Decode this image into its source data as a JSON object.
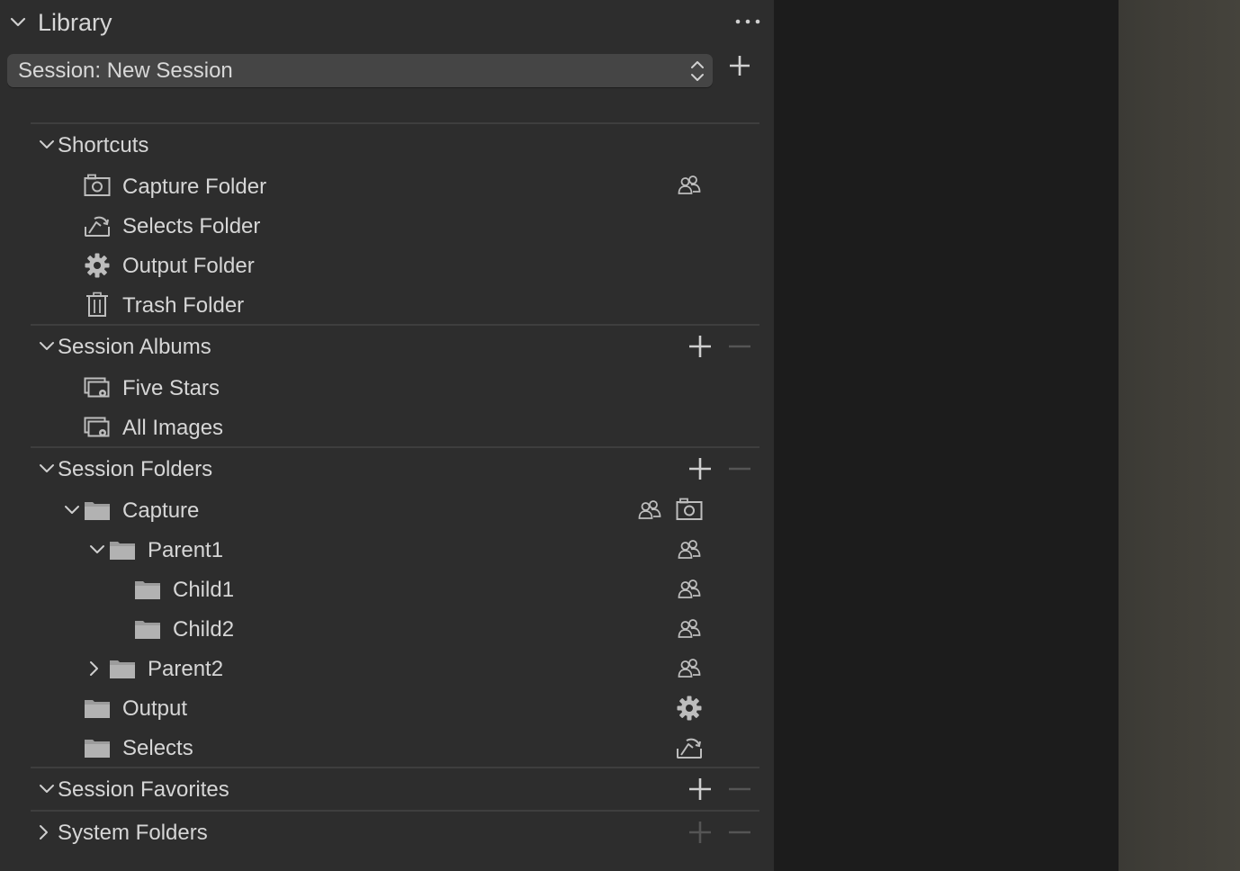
{
  "tool": {
    "title": "Library",
    "more_icon": "ellipsis-icon",
    "collapse_icon": "chevron-down-icon"
  },
  "session_select": {
    "value": "Session: New Session"
  },
  "shortcuts": {
    "title": "Shortcuts",
    "items": [
      {
        "label": "Capture Folder",
        "icon": "camera-folder-icon",
        "badge": "users-icon"
      },
      {
        "label": "Selects Folder",
        "icon": "selects-folder-icon"
      },
      {
        "label": "Output Folder",
        "icon": "gear-icon"
      },
      {
        "label": "Trash Folder",
        "icon": "trash-icon"
      }
    ]
  },
  "session_albums": {
    "title": "Session Albums",
    "items": [
      {
        "label": "Five Stars",
        "icon": "smart-album-icon"
      },
      {
        "label": "All Images",
        "icon": "smart-album-icon"
      }
    ]
  },
  "session_folders": {
    "title": "Session Folders",
    "items": [
      {
        "label": "Capture",
        "expanded": true,
        "badges": [
          "users-icon",
          "camera-icon"
        ]
      },
      {
        "label": "Parent1",
        "expanded": true,
        "badges": [
          "users-icon"
        ]
      },
      {
        "label": "Child1",
        "badges": [
          "users-icon"
        ]
      },
      {
        "label": "Child2",
        "badges": [
          "users-icon"
        ]
      },
      {
        "label": "Parent2",
        "expanded": false,
        "badges": [
          "users-icon"
        ]
      },
      {
        "label": "Output",
        "badges": [
          "gear-icon"
        ]
      },
      {
        "label": "Selects",
        "badges": [
          "selects-icon"
        ]
      }
    ]
  },
  "session_favorites": {
    "title": "Session Favorites"
  },
  "system_folders": {
    "title": "System Folders"
  },
  "colors": {
    "panel_bg": "#2d2d2d",
    "viewer_bg": "#1c1c1c",
    "text": "#d6d6d6",
    "icon": "#bdbdbd",
    "disabled": "#555555"
  }
}
